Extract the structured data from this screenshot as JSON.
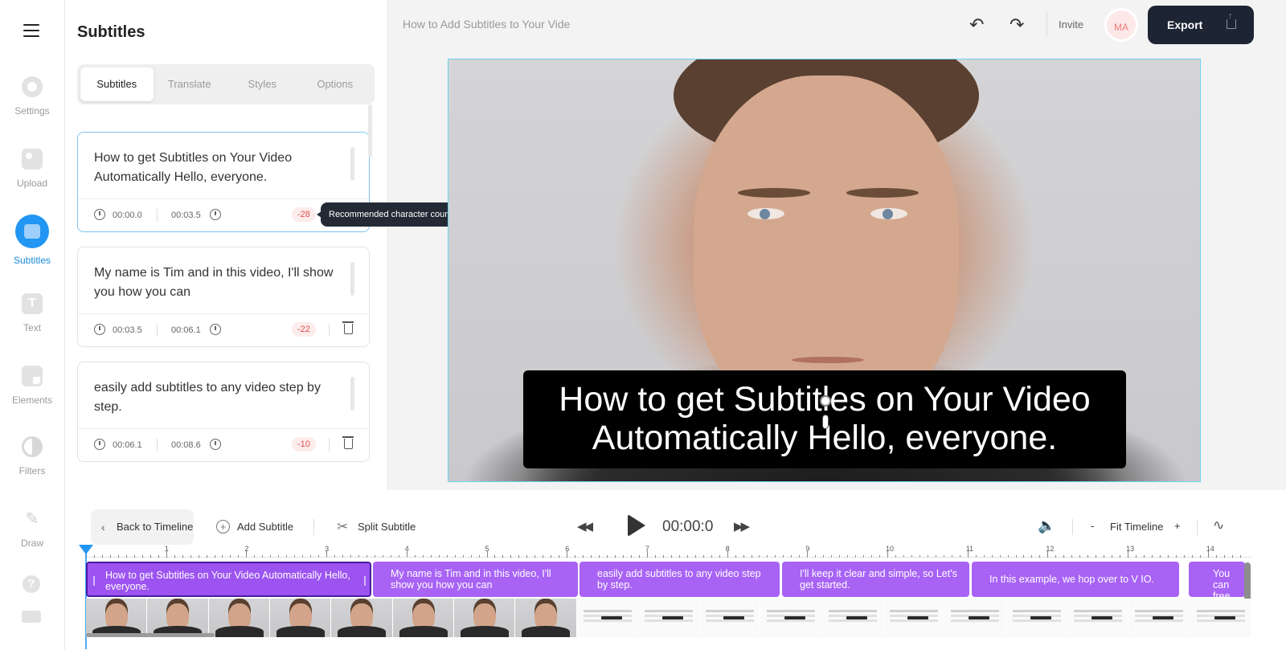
{
  "rail": {
    "items": [
      {
        "label": "Settings",
        "icon": "settings-icon"
      },
      {
        "label": "Upload",
        "icon": "upload-icon"
      },
      {
        "label": "Subtitles",
        "icon": "subtitles-icon",
        "active": true
      },
      {
        "label": "Text",
        "icon": "text-icon",
        "glyph": "T"
      },
      {
        "label": "Elements",
        "icon": "elements-icon"
      },
      {
        "label": "Filters",
        "icon": "filters-icon"
      },
      {
        "label": "Draw",
        "icon": "pencil-icon"
      }
    ],
    "help_glyph": "?"
  },
  "panel": {
    "title": "Subtitles",
    "tabs": [
      "Subtitles",
      "Translate",
      "Styles",
      "Options"
    ],
    "active_tab": "Subtitles",
    "cards": [
      {
        "text": "How to get Subtitles on Your Video Automatically Hello, everyone.",
        "start": "00:00.0",
        "end": "00:03.5",
        "count": "-28"
      },
      {
        "text": "My name is Tim and in this video, I'll show you how you can",
        "start": "00:03.5",
        "end": "00:06.1",
        "count": "-22"
      },
      {
        "text": "easily add subtitles to any video step by step.",
        "start": "00:06.1",
        "end": "00:08.6",
        "count": "-10"
      }
    ],
    "tooltip": "Recommended character count"
  },
  "topbar": {
    "doc_title": "How to Add Subtitles to Your Vide",
    "invite": "Invite",
    "avatar": "MA",
    "export": "Export",
    "undo_glyph": "↶",
    "redo_glyph": "↷"
  },
  "video": {
    "caption": "How to get Subtitles on Your Video Automatically Hello, everyone."
  },
  "controls": {
    "back": "Back to Timeline",
    "back_glyph": "‹",
    "add_subtitle": "Add Subtitle",
    "split_subtitle": "Split Subtitle",
    "timecode": "00:00:0",
    "fit": "Fit Timeline",
    "zoom_minus": "-",
    "zoom_plus": "+",
    "rewind_glyph": "◀◀",
    "forward_glyph": "▶▶",
    "volume_glyph": "🔈",
    "wave_glyph": "∿",
    "scissors_glyph": "✂",
    "plus_glyph": "+"
  },
  "timeline": {
    "ticks": [
      "1",
      "2",
      "3",
      "4",
      "5",
      "6",
      "7",
      "8",
      "9",
      "10",
      "11",
      "12",
      "13",
      "14"
    ],
    "subtitles": [
      "How to get Subtitles on Your Video Automatically Hello, everyone.",
      "My name is Tim and in this video, I'll show you how you can",
      "easily add subtitles to any video step by step.",
      "I'll keep it clear and simple, so Let's get started.",
      "In this example, we hop over to V IO.",
      "You can free to g"
    ]
  },
  "colors": {
    "accent": "#2196f3",
    "subtitle_block": "#a863f5",
    "export_bg": "#1d2433",
    "count_badge": "#e05050"
  }
}
